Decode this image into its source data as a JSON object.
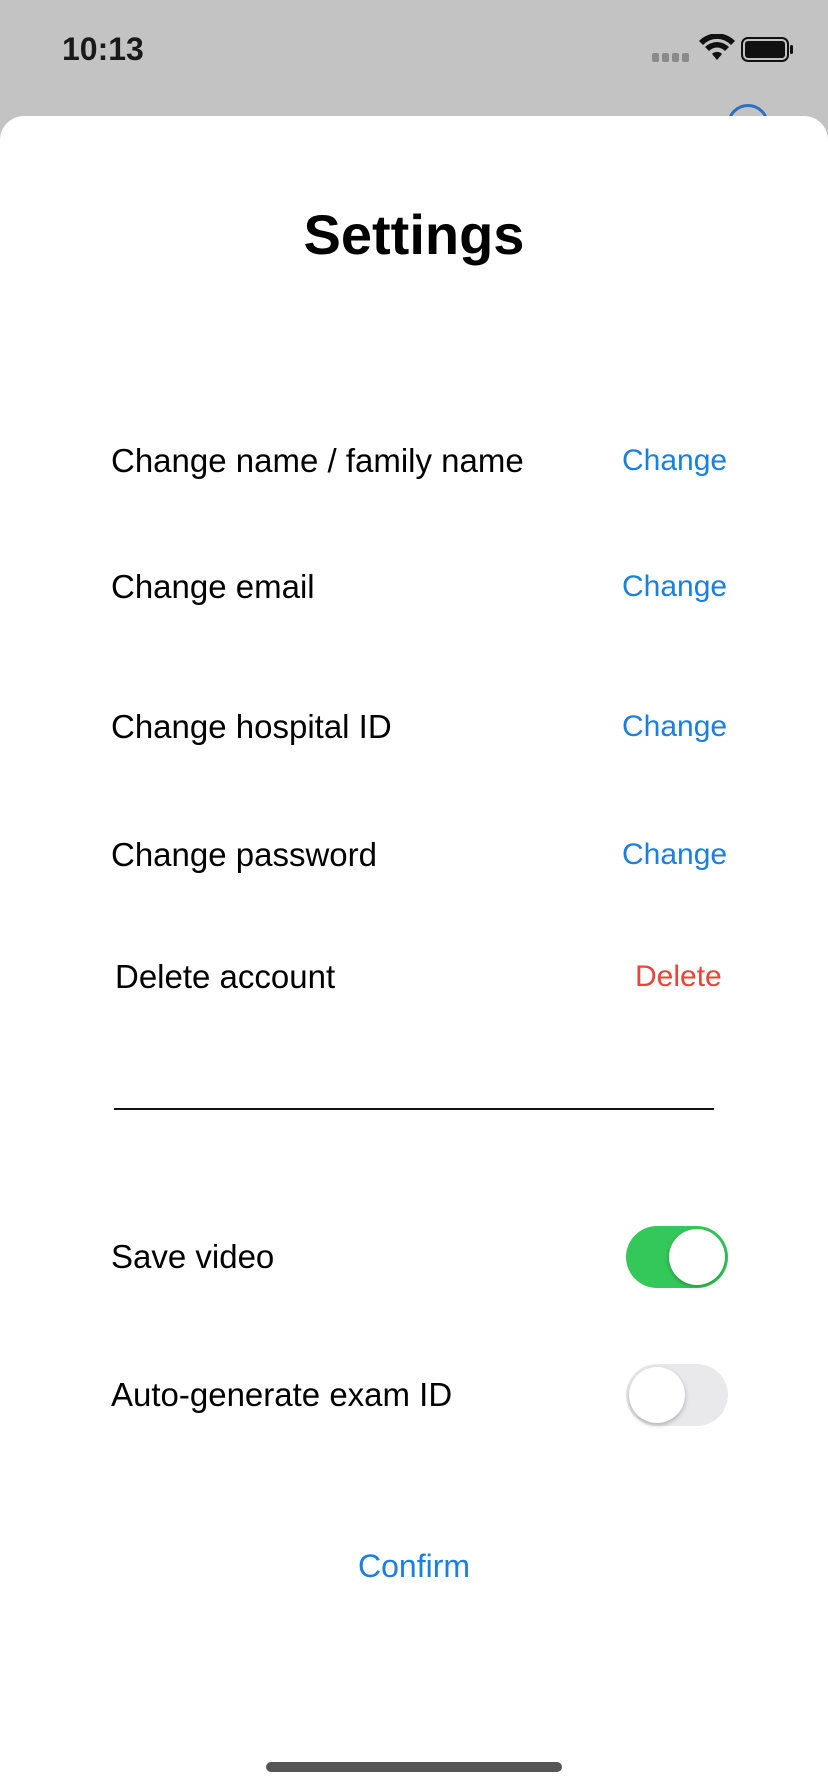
{
  "status_bar": {
    "time": "10:13",
    "icons": [
      "signal-icon",
      "wifi-icon",
      "battery-icon"
    ]
  },
  "settings": {
    "title": "Settings",
    "rows": [
      {
        "label": "Change name / family name",
        "action": "Change"
      },
      {
        "label": "Change email",
        "action": "Change"
      },
      {
        "label": "Change hospital ID",
        "action": "Change"
      },
      {
        "label": "Change password",
        "action": "Change"
      },
      {
        "label": "Delete account",
        "action": "Delete"
      }
    ],
    "toggles": [
      {
        "label": "Save video",
        "on": true
      },
      {
        "label": "Auto-generate exam ID",
        "on": false
      }
    ],
    "confirm_label": "Confirm"
  },
  "colors": {
    "accent": "#1a7fe0",
    "destructive": "#e8453a",
    "toggle_on": "#34c759",
    "toggle_off": "#e9e9eb"
  }
}
